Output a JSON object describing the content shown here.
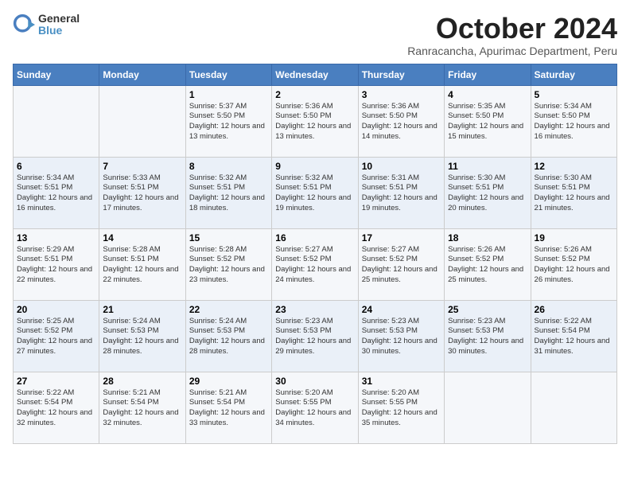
{
  "header": {
    "logo_line1": "General",
    "logo_line2": "Blue",
    "month": "October 2024",
    "location": "Ranracancha, Apurimac Department, Peru"
  },
  "weekdays": [
    "Sunday",
    "Monday",
    "Tuesday",
    "Wednesday",
    "Thursday",
    "Friday",
    "Saturday"
  ],
  "weeks": [
    [
      {
        "day": "",
        "sunrise": "",
        "sunset": "",
        "daylight": ""
      },
      {
        "day": "",
        "sunrise": "",
        "sunset": "",
        "daylight": ""
      },
      {
        "day": "1",
        "sunrise": "Sunrise: 5:37 AM",
        "sunset": "Sunset: 5:50 PM",
        "daylight": "Daylight: 12 hours and 13 minutes."
      },
      {
        "day": "2",
        "sunrise": "Sunrise: 5:36 AM",
        "sunset": "Sunset: 5:50 PM",
        "daylight": "Daylight: 12 hours and 13 minutes."
      },
      {
        "day": "3",
        "sunrise": "Sunrise: 5:36 AM",
        "sunset": "Sunset: 5:50 PM",
        "daylight": "Daylight: 12 hours and 14 minutes."
      },
      {
        "day": "4",
        "sunrise": "Sunrise: 5:35 AM",
        "sunset": "Sunset: 5:50 PM",
        "daylight": "Daylight: 12 hours and 15 minutes."
      },
      {
        "day": "5",
        "sunrise": "Sunrise: 5:34 AM",
        "sunset": "Sunset: 5:50 PM",
        "daylight": "Daylight: 12 hours and 16 minutes."
      }
    ],
    [
      {
        "day": "6",
        "sunrise": "Sunrise: 5:34 AM",
        "sunset": "Sunset: 5:51 PM",
        "daylight": "Daylight: 12 hours and 16 minutes."
      },
      {
        "day": "7",
        "sunrise": "Sunrise: 5:33 AM",
        "sunset": "Sunset: 5:51 PM",
        "daylight": "Daylight: 12 hours and 17 minutes."
      },
      {
        "day": "8",
        "sunrise": "Sunrise: 5:32 AM",
        "sunset": "Sunset: 5:51 PM",
        "daylight": "Daylight: 12 hours and 18 minutes."
      },
      {
        "day": "9",
        "sunrise": "Sunrise: 5:32 AM",
        "sunset": "Sunset: 5:51 PM",
        "daylight": "Daylight: 12 hours and 19 minutes."
      },
      {
        "day": "10",
        "sunrise": "Sunrise: 5:31 AM",
        "sunset": "Sunset: 5:51 PM",
        "daylight": "Daylight: 12 hours and 19 minutes."
      },
      {
        "day": "11",
        "sunrise": "Sunrise: 5:30 AM",
        "sunset": "Sunset: 5:51 PM",
        "daylight": "Daylight: 12 hours and 20 minutes."
      },
      {
        "day": "12",
        "sunrise": "Sunrise: 5:30 AM",
        "sunset": "Sunset: 5:51 PM",
        "daylight": "Daylight: 12 hours and 21 minutes."
      }
    ],
    [
      {
        "day": "13",
        "sunrise": "Sunrise: 5:29 AM",
        "sunset": "Sunset: 5:51 PM",
        "daylight": "Daylight: 12 hours and 22 minutes."
      },
      {
        "day": "14",
        "sunrise": "Sunrise: 5:28 AM",
        "sunset": "Sunset: 5:51 PM",
        "daylight": "Daylight: 12 hours and 22 minutes."
      },
      {
        "day": "15",
        "sunrise": "Sunrise: 5:28 AM",
        "sunset": "Sunset: 5:52 PM",
        "daylight": "Daylight: 12 hours and 23 minutes."
      },
      {
        "day": "16",
        "sunrise": "Sunrise: 5:27 AM",
        "sunset": "Sunset: 5:52 PM",
        "daylight": "Daylight: 12 hours and 24 minutes."
      },
      {
        "day": "17",
        "sunrise": "Sunrise: 5:27 AM",
        "sunset": "Sunset: 5:52 PM",
        "daylight": "Daylight: 12 hours and 25 minutes."
      },
      {
        "day": "18",
        "sunrise": "Sunrise: 5:26 AM",
        "sunset": "Sunset: 5:52 PM",
        "daylight": "Daylight: 12 hours and 25 minutes."
      },
      {
        "day": "19",
        "sunrise": "Sunrise: 5:26 AM",
        "sunset": "Sunset: 5:52 PM",
        "daylight": "Daylight: 12 hours and 26 minutes."
      }
    ],
    [
      {
        "day": "20",
        "sunrise": "Sunrise: 5:25 AM",
        "sunset": "Sunset: 5:52 PM",
        "daylight": "Daylight: 12 hours and 27 minutes."
      },
      {
        "day": "21",
        "sunrise": "Sunrise: 5:24 AM",
        "sunset": "Sunset: 5:53 PM",
        "daylight": "Daylight: 12 hours and 28 minutes."
      },
      {
        "day": "22",
        "sunrise": "Sunrise: 5:24 AM",
        "sunset": "Sunset: 5:53 PM",
        "daylight": "Daylight: 12 hours and 28 minutes."
      },
      {
        "day": "23",
        "sunrise": "Sunrise: 5:23 AM",
        "sunset": "Sunset: 5:53 PM",
        "daylight": "Daylight: 12 hours and 29 minutes."
      },
      {
        "day": "24",
        "sunrise": "Sunrise: 5:23 AM",
        "sunset": "Sunset: 5:53 PM",
        "daylight": "Daylight: 12 hours and 30 minutes."
      },
      {
        "day": "25",
        "sunrise": "Sunrise: 5:23 AM",
        "sunset": "Sunset: 5:53 PM",
        "daylight": "Daylight: 12 hours and 30 minutes."
      },
      {
        "day": "26",
        "sunrise": "Sunrise: 5:22 AM",
        "sunset": "Sunset: 5:54 PM",
        "daylight": "Daylight: 12 hours and 31 minutes."
      }
    ],
    [
      {
        "day": "27",
        "sunrise": "Sunrise: 5:22 AM",
        "sunset": "Sunset: 5:54 PM",
        "daylight": "Daylight: 12 hours and 32 minutes."
      },
      {
        "day": "28",
        "sunrise": "Sunrise: 5:21 AM",
        "sunset": "Sunset: 5:54 PM",
        "daylight": "Daylight: 12 hours and 32 minutes."
      },
      {
        "day": "29",
        "sunrise": "Sunrise: 5:21 AM",
        "sunset": "Sunset: 5:54 PM",
        "daylight": "Daylight: 12 hours and 33 minutes."
      },
      {
        "day": "30",
        "sunrise": "Sunrise: 5:20 AM",
        "sunset": "Sunset: 5:55 PM",
        "daylight": "Daylight: 12 hours and 34 minutes."
      },
      {
        "day": "31",
        "sunrise": "Sunrise: 5:20 AM",
        "sunset": "Sunset: 5:55 PM",
        "daylight": "Daylight: 12 hours and 35 minutes."
      },
      {
        "day": "",
        "sunrise": "",
        "sunset": "",
        "daylight": ""
      },
      {
        "day": "",
        "sunrise": "",
        "sunset": "",
        "daylight": ""
      }
    ]
  ]
}
